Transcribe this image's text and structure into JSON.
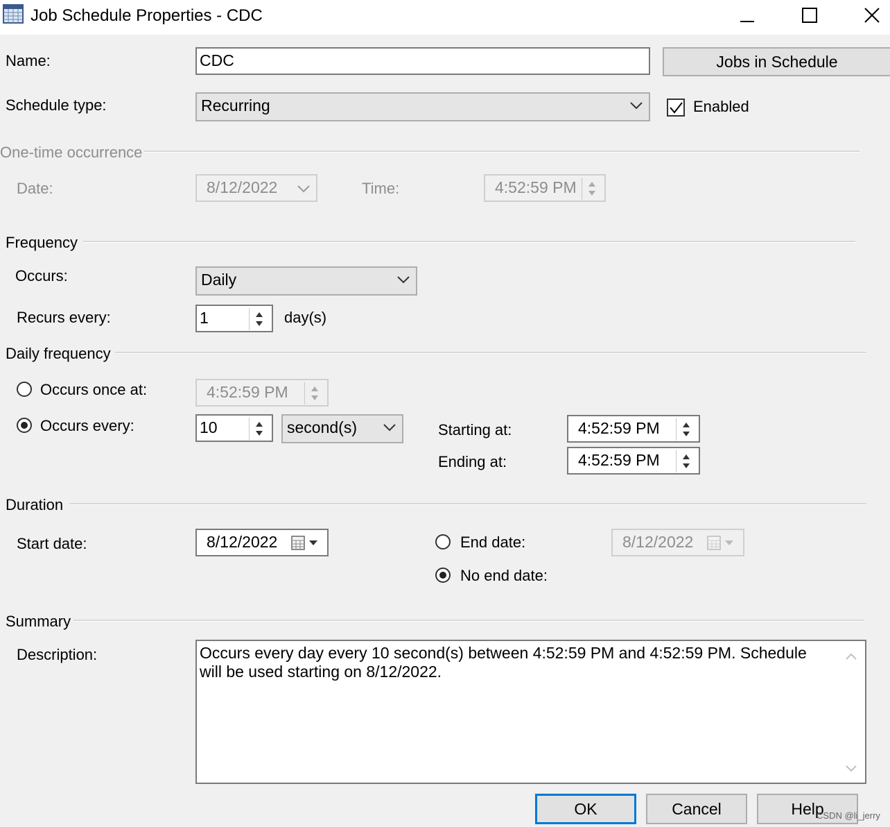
{
  "window": {
    "title": "Job Schedule Properties - CDC"
  },
  "name": {
    "label": "Name:",
    "value": "CDC"
  },
  "jobs_button": "Jobs in Schedule",
  "schedule_type": {
    "label": "Schedule type:",
    "value": "Recurring"
  },
  "enabled": {
    "label": "Enabled",
    "checked": true
  },
  "one_time": {
    "heading": "One-time occurrence",
    "date_label": "Date:",
    "date_value": "8/12/2022",
    "time_label": "Time:",
    "time_value": "4:52:59 PM"
  },
  "frequency": {
    "heading": "Frequency",
    "occurs_label": "Occurs:",
    "occurs_value": "Daily",
    "recurs_label": "Recurs every:",
    "recurs_value": "1",
    "recurs_unit": "day(s)"
  },
  "daily": {
    "heading": "Daily frequency",
    "once_label": "Occurs once at:",
    "once_value": "4:52:59 PM",
    "every_label": "Occurs every:",
    "every_value": "10",
    "every_unit": "second(s)",
    "starting_label": "Starting at:",
    "starting_value": "4:52:59 PM",
    "ending_label": "Ending at:",
    "ending_value": "4:52:59 PM",
    "selected": "every"
  },
  "duration": {
    "heading": "Duration",
    "start_label": "Start date:",
    "start_value": "8/12/2022",
    "end_label": "End date:",
    "end_value": "8/12/2022",
    "no_end_label": "No end date:",
    "selected": "no_end"
  },
  "summary": {
    "heading": "Summary",
    "desc_label": "Description:",
    "desc_value": "Occurs every day every 10 second(s) between 4:52:59 PM and 4:52:59 PM. Schedule will be used starting on 8/12/2022."
  },
  "buttons": {
    "ok": "OK",
    "cancel": "Cancel",
    "help": "Help"
  },
  "watermark": "CSDN @li_jerry",
  "colors": {
    "accent": "#0078d7",
    "background": "#f0f0f0",
    "disabled_text": "#8d8d8d"
  }
}
